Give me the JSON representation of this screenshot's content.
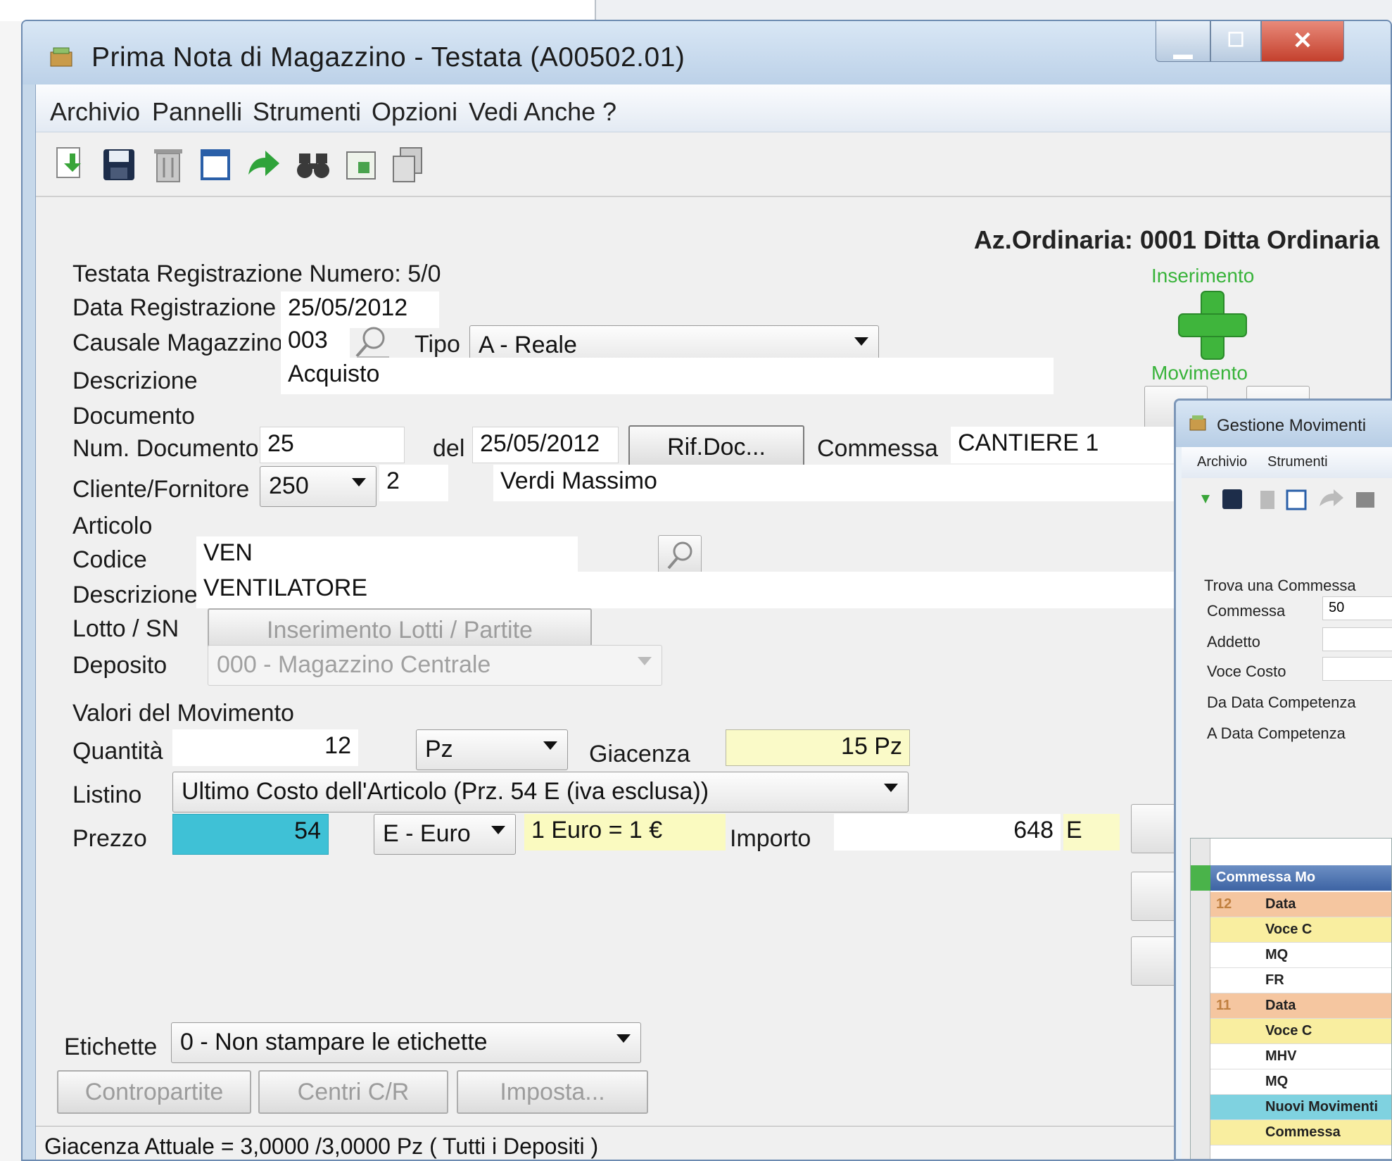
{
  "window": {
    "title": "Prima Nota di Magazzino  -  Testata  (A00502.01)",
    "close_glyph": "✕"
  },
  "menu": [
    "Archivio",
    "Pannelli",
    "Strumenti",
    "Opzioni",
    "Vedi Anche",
    "?"
  ],
  "toolbar_icons": [
    "new-icon",
    "save-icon",
    "delete-icon",
    "window-icon",
    "forward-icon",
    "search-binoculars-icon",
    "document-icon",
    "copy-icon"
  ],
  "company": "Az.Ordinaria: 0001 Ditta Ordinaria",
  "header": {
    "registration_number_label": "Testata Registrazione Numero: 5/0",
    "data_registrazione_label": "Data Registrazione",
    "data_registrazione_value": "25/05/2012",
    "causale_label": "Causale Magazzino",
    "causale_value": "003",
    "tipo_label": "Tipo",
    "tipo_value": "A - Reale",
    "descrizione_label": "Descrizione",
    "descrizione_value": "Acquisto"
  },
  "side": {
    "inserimento": "Inserimento",
    "movimento": "Movimento"
  },
  "documento": {
    "section_label": "Documento",
    "num_label": "Num. Documento",
    "num_value": "25",
    "del_label": "del",
    "del_value": "25/05/2012",
    "rif_button": "Rif.Doc...",
    "commessa_label": "Commessa",
    "commessa_value": "CANTIERE 1",
    "cliente_label": "Cliente/Fornitore",
    "cliente_code": "250",
    "cliente_sub": "2",
    "cliente_name": "Verdi Massimo"
  },
  "articolo": {
    "section_label": "Articolo",
    "codice_label": "Codice",
    "codice_value": "VEN",
    "descrizione_label": "Descrizione",
    "descrizione_value": "VENTILATORE",
    "lotto_label": "Lotto / SN",
    "lotto_button": "Inserimento Lotti / Partite",
    "deposito_label": "Deposito",
    "deposito_value": "000 - Magazzino Centrale"
  },
  "valori": {
    "section_label": "Valori del Movimento",
    "quantita_label": "Quantità",
    "quantita_value": "12",
    "um_value": "Pz",
    "giacenza_label": "Giacenza",
    "giacenza_value": "15 Pz",
    "listino_label": "Listino",
    "listino_value": "Ultimo Costo dell'Articolo (Prz. 54 E (iva esclusa))",
    "prezzo_label": "Prezzo",
    "prezzo_value": "54",
    "valuta_value": "E - Euro",
    "cambio_value": "1 Euro = 1 €",
    "importo_label": "Importo",
    "importo_value": "648",
    "importo_currency": "E"
  },
  "etichette": {
    "label": "Etichette",
    "value": "0 - Non stampare le etichette"
  },
  "bottom_buttons": [
    "Contropartite",
    "Centri C/R",
    "Imposta..."
  ],
  "status": "Giacenza Attuale = 3,0000 /3,0000 Pz  ( Tutti i Depositi )",
  "window2": {
    "title": "Gestione Movimenti",
    "menu": [
      "Archivio",
      "Strumenti"
    ],
    "trova_label": "Trova una Commessa",
    "commessa_label": "Commessa",
    "commessa_value": "50",
    "addetto_label": "Addetto",
    "voce_label": "Voce Costo",
    "da_label": "Da Data Competenza",
    "a_label": "A Data Competenza",
    "grid_header": "Commessa  Mo",
    "grid_rows": [
      {
        "num": "12",
        "text": "Data",
        "color": "#f5c6a0"
      },
      {
        "num": "",
        "text": "Voce C",
        "color": "#f9eea0"
      },
      {
        "num": "",
        "text": "MQ",
        "color": "#ffffff"
      },
      {
        "num": "",
        "text": "FR",
        "color": "#ffffff"
      },
      {
        "num": "11",
        "text": "Data",
        "color": "#f5c6a0"
      },
      {
        "num": "",
        "text": "Voce C",
        "color": "#f9eea0"
      },
      {
        "num": "",
        "text": "MHV",
        "color": "#ffffff"
      },
      {
        "num": "",
        "text": "MQ",
        "color": "#ffffff"
      },
      {
        "num": "",
        "text": "Nuovi Movimenti",
        "color": "#7fd2e0"
      },
      {
        "num": "",
        "text": "Commessa",
        "color": "#f9eea0"
      }
    ]
  }
}
